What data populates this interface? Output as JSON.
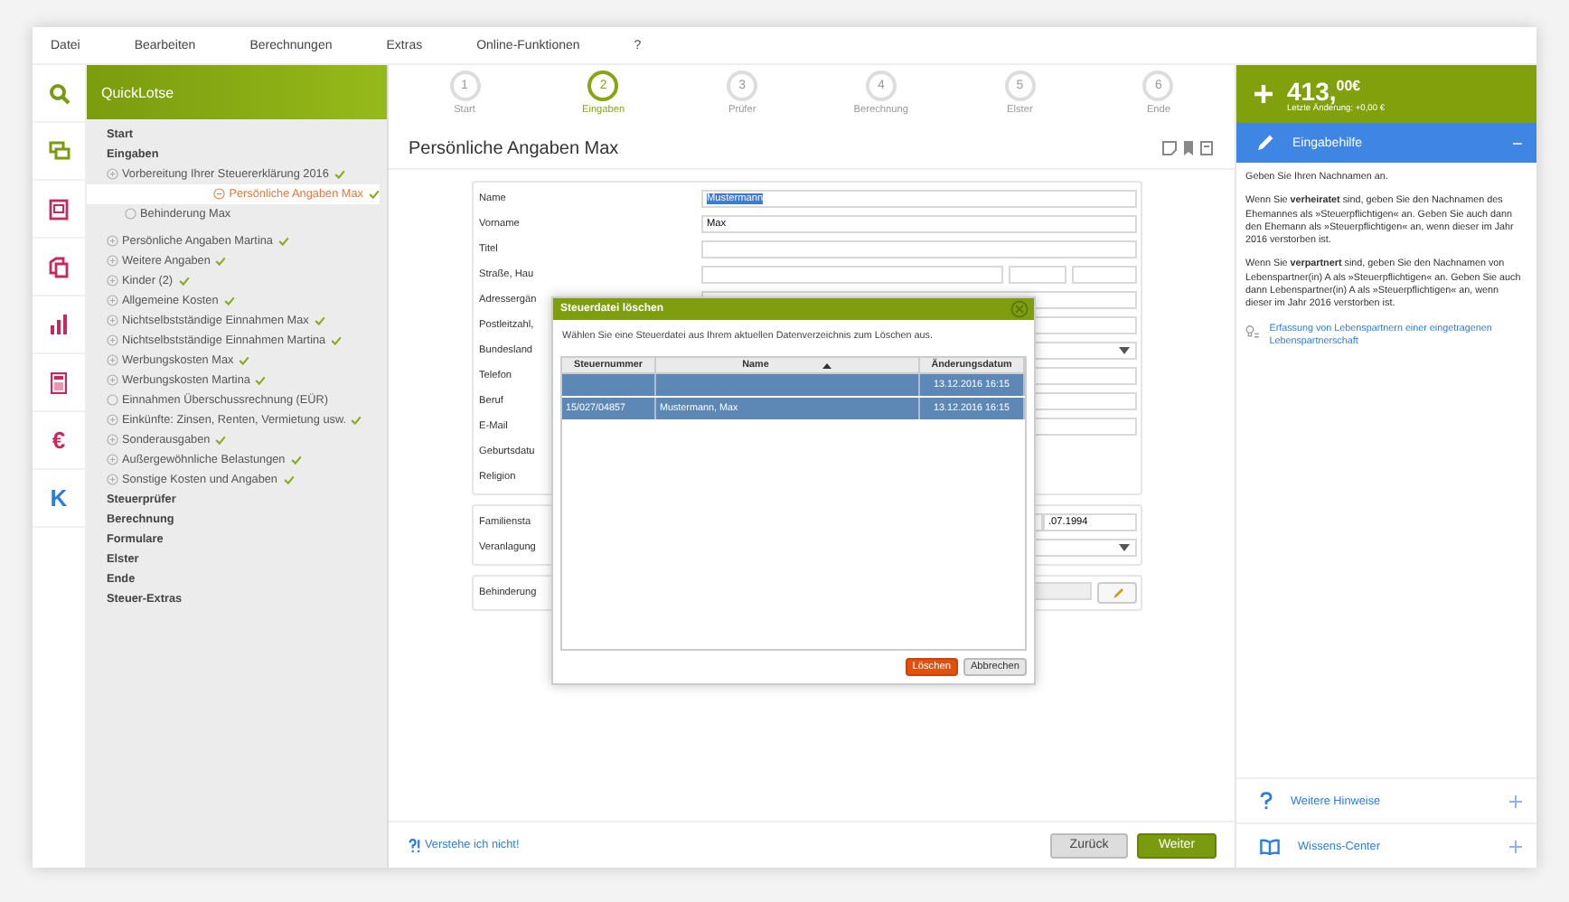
{
  "menu": [
    {
      "label": "Datei"
    },
    {
      "label": "Bearbeiten"
    },
    {
      "label": "Berechnungen"
    },
    {
      "label": "Extras"
    },
    {
      "label": "Online-Funktionen"
    },
    {
      "label": "?"
    }
  ],
  "icon_bar": [
    {
      "kind": "search"
    },
    {
      "kind": "chat"
    },
    {
      "kind": "form"
    },
    {
      "kind": "copy"
    },
    {
      "kind": "chart"
    },
    {
      "kind": "calculator"
    },
    {
      "kind": "glyph",
      "text": "€",
      "color": "#c8285a"
    },
    {
      "kind": "glyph",
      "text": "K",
      "color": "#2a7de1"
    }
  ],
  "quicklotse": {
    "title": "QuickLotse",
    "sections": [
      {
        "label": "Start"
      },
      {
        "label": "Eingaben",
        "items": [
          {
            "label": "Vorbereitung Ihrer Steuererklärung 2016",
            "kind": "group",
            "expanded": false,
            "done": true,
            "selected": false
          },
          {
            "label": "Persönliche Angaben Max",
            "kind": "group",
            "expanded": true,
            "done": true,
            "selected": true,
            "children": [
              {
                "label": "Behinderung Max",
                "kind": "leaf",
                "done": false,
                "selected": false
              }
            ]
          },
          {
            "label": "Persönliche Angaben Martina",
            "kind": "group",
            "expanded": false,
            "done": true,
            "selected": false
          },
          {
            "label": "Weitere Angaben",
            "kind": "group",
            "expanded": false,
            "done": true,
            "selected": false
          },
          {
            "label": "Kinder (2)",
            "kind": "group",
            "expanded": false,
            "done": true,
            "selected": false
          },
          {
            "label": "Allgemeine Kosten",
            "kind": "group",
            "expanded": false,
            "done": true,
            "selected": false
          },
          {
            "label": "Nichtselbstständige Einnahmen Max",
            "kind": "group",
            "expanded": false,
            "done": true,
            "selected": false
          },
          {
            "label": "Nichtselbstständige Einnahmen Martina",
            "kind": "group",
            "expanded": false,
            "done": true,
            "selected": false
          },
          {
            "label": "Werbungskosten Max",
            "kind": "group",
            "expanded": false,
            "done": true,
            "selected": false
          },
          {
            "label": "Werbungskosten Martina",
            "kind": "group",
            "expanded": false,
            "done": true,
            "selected": false
          },
          {
            "label": "Einnahmen Überschussrechnung (EÜR)",
            "kind": "leaf",
            "done": false,
            "selected": false
          },
          {
            "label": "Einkünfte: Zinsen, Renten, Vermietung usw.",
            "kind": "group",
            "expanded": false,
            "done": true,
            "selected": false
          },
          {
            "label": "Sonderausgaben",
            "kind": "group",
            "expanded": false,
            "done": true,
            "selected": false
          },
          {
            "label": "Außergewöhnliche Belastungen",
            "kind": "group",
            "expanded": false,
            "done": true,
            "selected": false
          },
          {
            "label": "Sonstige Kosten und Angaben",
            "kind": "group",
            "expanded": false,
            "done": true,
            "selected": false
          }
        ]
      },
      {
        "label": "Steuerprüfer"
      },
      {
        "label": "Berechnung"
      },
      {
        "label": "Formulare"
      },
      {
        "label": "Elster"
      },
      {
        "label": "Ende"
      },
      {
        "label": "Steuer-Extras"
      }
    ]
  },
  "steps": [
    {
      "number": "1",
      "label": "Start",
      "selected": false
    },
    {
      "number": "2",
      "label": "Eingaben",
      "selected": true
    },
    {
      "number": "3",
      "label": "Prüfer",
      "selected": false
    },
    {
      "number": "4",
      "label": "Berechnung",
      "selected": false
    },
    {
      "number": "5",
      "label": "Elster",
      "selected": false
    },
    {
      "number": "6",
      "label": "Ende",
      "selected": false
    }
  ],
  "page_title": "Persönliche Angaben Max",
  "form_groups": [
    [
      {
        "label": "Name",
        "kind": "text",
        "value": "Mustermann",
        "text_selected": true
      },
      {
        "label": "Vorname",
        "kind": "text",
        "value": "Max"
      },
      {
        "label": "Titel",
        "kind": "text"
      },
      {
        "label": "Straße, Hau",
        "kind": "split"
      },
      {
        "label": "Adressergän",
        "kind": "text"
      },
      {
        "label": "Postleitzahl,",
        "kind": "text"
      },
      {
        "label": "Bundesland",
        "kind": "select"
      },
      {
        "label": "Telefon",
        "kind": "text"
      },
      {
        "label": "Beruf",
        "kind": "text"
      },
      {
        "label": "E-Mail",
        "kind": "text"
      },
      {
        "label": "Geburtsdatu",
        "kind": "none"
      },
      {
        "label": "Religion",
        "kind": "none"
      }
    ],
    [
      {
        "label": "Familiensta",
        "kind": "date",
        "value": ".07.1994"
      },
      {
        "label": "Veranlagung",
        "kind": "select"
      }
    ],
    [
      {
        "label": "Behinderung",
        "kind": "edit"
      }
    ]
  ],
  "dialog": {
    "title": "Steuerdatei löschen",
    "text": "Wählen Sie eine Steuerdatei aus Ihrem aktuellen Datenverzeichnis zum Löschen aus.",
    "columns": [
      "Steuernummer",
      "Name",
      "Änderungsdatum"
    ],
    "rows": [
      {
        "date": "13.12.2016 16:15",
        "selected": true
      },
      {
        "tax_number": "15/027/04857",
        "name": "Mustermann, Max",
        "date": "13.12.2016 16:15",
        "selected": true
      }
    ],
    "buttons": [
      {
        "label": "Löschen",
        "kind": "danger"
      },
      {
        "label": "Abbrechen",
        "kind": "plain"
      }
    ]
  },
  "help_link": "Verstehe ich nicht!",
  "nav_buttons": [
    {
      "label": "Zurück",
      "kind": "plain"
    },
    {
      "label": "Weiter",
      "kind": "primary"
    }
  ],
  "total": {
    "amount": "413,$^{00€}$",
    "change": "Letzte Änderung: +0,00 €"
  },
  "assist": {
    "title": "Eingabehilfe",
    "paragraphs": [
      "Geben Sie Ihren Nachnamen an.",
      "Wenn Sie **verheiratet** sind, geben Sie den Nachnamen des Ehemannes als »Steuerpflichtigen« an. Geben Sie auch dann den Ehemann als »Steuerpflichtigen« an, wenn dieser im Jahr 2016 verstorben ist.",
      "Wenn Sie **verpartnert** sind, geben Sie den Nachnamen von Lebenspartner(in) A als »Steuerpflichtigen« an. Geben Sie auch dann Lebenspartner(in) A als »Steuerpflichtigen« an, wenn dieser im Jahr 2016 verstorben ist."
    ],
    "link": "Erfassung von Lebenspartnern einer eingetragenen Lebenspartnerschaft"
  },
  "extra_panels": [
    {
      "label": "Weitere Hinweise",
      "kind": "question"
    },
    {
      "label": "Wissens-Center",
      "kind": "book"
    }
  ]
}
